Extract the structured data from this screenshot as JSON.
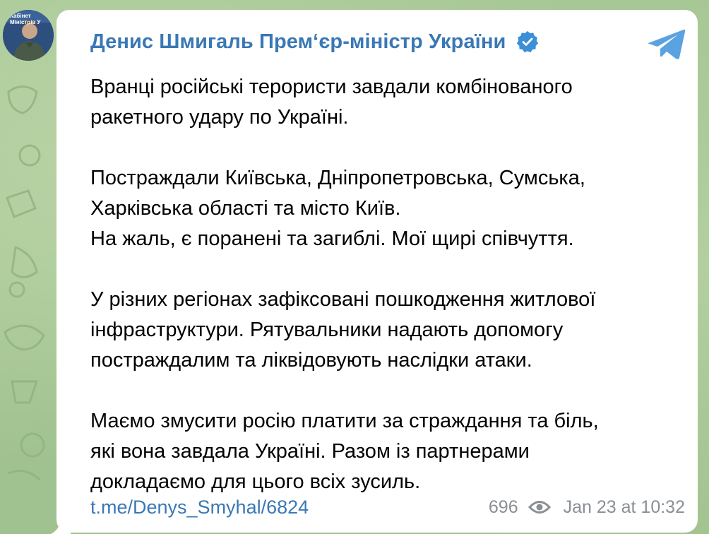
{
  "channel": {
    "sender_name": "Денис Шмигаль Прем‘єр-міністр України",
    "verified_icon": "verified-badge-icon",
    "avatar_banner_lines": [
      "Кабінет",
      "Міністрів У"
    ]
  },
  "message": {
    "paragraphs": [
      {
        "lines": [
          "Вранці російські терористи завдали комбінованого",
          "ракетного удару по Україні."
        ]
      },
      {
        "lines": [
          "Постраждали Київська, Дніпропетровська, Сумська,",
          "Харківська області та місто Київ.",
          "На жаль, є поранені та загиблі. Мої щирі співчуття."
        ]
      },
      {
        "lines": [
          "У різних регіонах зафіксовані пошкодження житлової",
          "інфраструктури. Рятувальники надають допомогу",
          "постраждалим та ліквідовують наслідки атаки."
        ]
      },
      {
        "lines": [
          "Маємо змусити росію платити за страждання та біль,",
          "які вона завдала Україні. Разом із партнерами",
          "докладаємо для цього всіх зусиль."
        ]
      }
    ],
    "link": "t.me/Denys_Smyhal/6824",
    "views": "696",
    "timestamp": "Jan 23 at 10:32"
  },
  "colors": {
    "accent": "#3a78b5",
    "meta": "#8a8f94",
    "background": "#a9c79a",
    "bubble": "#ffffff"
  },
  "icons": {
    "share": "telegram-share-icon",
    "views": "eye-icon"
  }
}
